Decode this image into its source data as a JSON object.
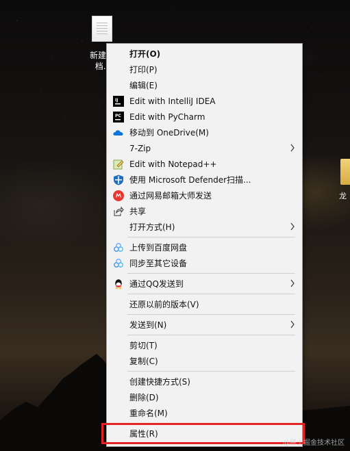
{
  "desktop": {
    "file": {
      "label_lines": "新建文\n档.t"
    },
    "right_label": "龙"
  },
  "menu": {
    "items": [
      {
        "label": "打开(O)",
        "icon": "none",
        "submenu": false
      },
      {
        "label": "打印(P)",
        "icon": "none",
        "submenu": false
      },
      {
        "label": "编辑(E)",
        "icon": "none",
        "submenu": false
      },
      {
        "label": "Edit with IntelliJ IDEA",
        "icon": "intellij-icon",
        "submenu": false
      },
      {
        "label": "Edit with PyCharm",
        "icon": "pycharm-icon",
        "submenu": false
      },
      {
        "label": "移动到 OneDrive(M)",
        "icon": "onedrive-icon",
        "submenu": false
      },
      {
        "label": "7-Zip",
        "icon": "none",
        "submenu": true
      },
      {
        "label": "Edit with Notepad++",
        "icon": "notepad-icon",
        "submenu": false
      },
      {
        "label": "使用 Microsoft Defender扫描...",
        "icon": "defender-icon",
        "submenu": false
      },
      {
        "label": "通过网易邮箱大师发送",
        "icon": "netease-mail-icon",
        "submenu": false
      },
      {
        "label": "共享",
        "icon": "share-icon",
        "submenu": false
      },
      {
        "label": "打开方式(H)",
        "icon": "none",
        "submenu": true
      },
      {
        "label": "上传到百度网盘",
        "icon": "baidu-netdisk-icon",
        "submenu": false
      },
      {
        "label": "同步至其它设备",
        "icon": "baidu-netdisk-icon",
        "submenu": false
      },
      {
        "label": "通过QQ发送到",
        "icon": "qq-icon",
        "submenu": true
      },
      {
        "label": "还原以前的版本(V)",
        "icon": "none",
        "submenu": false
      },
      {
        "label": "发送到(N)",
        "icon": "none",
        "submenu": true
      },
      {
        "label": "剪切(T)",
        "icon": "none",
        "submenu": false
      },
      {
        "label": "复制(C)",
        "icon": "none",
        "submenu": false
      },
      {
        "label": "创建快捷方式(S)",
        "icon": "none",
        "submenu": false
      },
      {
        "label": "删除(D)",
        "icon": "none",
        "submenu": false
      },
      {
        "label": "重命名(M)",
        "icon": "none",
        "submenu": false
      },
      {
        "label": "属性(R)",
        "icon": "none",
        "submenu": false
      }
    ]
  },
  "watermark": "@稀土掘金技术社区",
  "colors": {
    "menu_bg": "#f2f2f2",
    "highlight": "#e32226"
  }
}
